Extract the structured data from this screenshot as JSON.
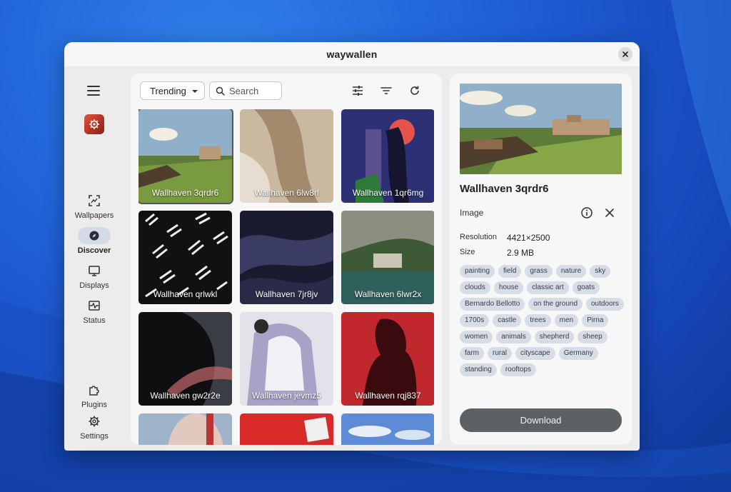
{
  "window": {
    "title": "waywallen"
  },
  "sidebar": {
    "items": [
      {
        "label": "Wallpapers",
        "icon": "wallpapers-icon",
        "active": false
      },
      {
        "label": "Discover",
        "icon": "compass-icon",
        "active": true
      },
      {
        "label": "Displays",
        "icon": "monitor-icon",
        "active": false
      },
      {
        "label": "Status",
        "icon": "pulse-icon",
        "active": false
      },
      {
        "label": "Plugins",
        "icon": "puzzle-icon",
        "active": false
      },
      {
        "label": "Settings",
        "icon": "gear-icon",
        "active": false
      }
    ]
  },
  "toolbar": {
    "sort_value": "Trending",
    "search_placeholder": "Search",
    "icons": [
      "sliders-icon",
      "filter-icon",
      "refresh-icon"
    ]
  },
  "grid": {
    "tiles": [
      {
        "caption": "Wallhaven 3qrdr6",
        "selected": true
      },
      {
        "caption": "Wallhaven 6lw8rl",
        "selected": false
      },
      {
        "caption": "Wallhaven 1qr6mg",
        "selected": false
      },
      {
        "caption": "Wallhaven qrlwkl",
        "selected": false
      },
      {
        "caption": "Wallhaven 7jr8jv",
        "selected": false
      },
      {
        "caption": "Wallhaven 6lwr2x",
        "selected": false
      },
      {
        "caption": "Wallhaven gw2r2e",
        "selected": false
      },
      {
        "caption": "Wallhaven jevmz5",
        "selected": false
      },
      {
        "caption": "Wallhaven rqj837",
        "selected": false
      }
    ]
  },
  "detail": {
    "title": "Wallhaven 3qrdr6",
    "section": "Image",
    "resolution_label": "Resolution",
    "resolution_value": "4421×2500",
    "size_label": "Size",
    "size_value": "2.9 MB",
    "tags": [
      "painting",
      "field",
      "grass",
      "nature",
      "sky",
      "clouds",
      "house",
      "classic art",
      "goats",
      "Bernardo Bellotto",
      "on the ground",
      "outdoors",
      "1700s",
      "castle",
      "trees",
      "men",
      "Pirna",
      "women",
      "animals",
      "shepherd",
      "sheep",
      "farm",
      "rural",
      "cityscape",
      "Germany",
      "standing",
      "rooftops"
    ],
    "download_label": "Download"
  }
}
